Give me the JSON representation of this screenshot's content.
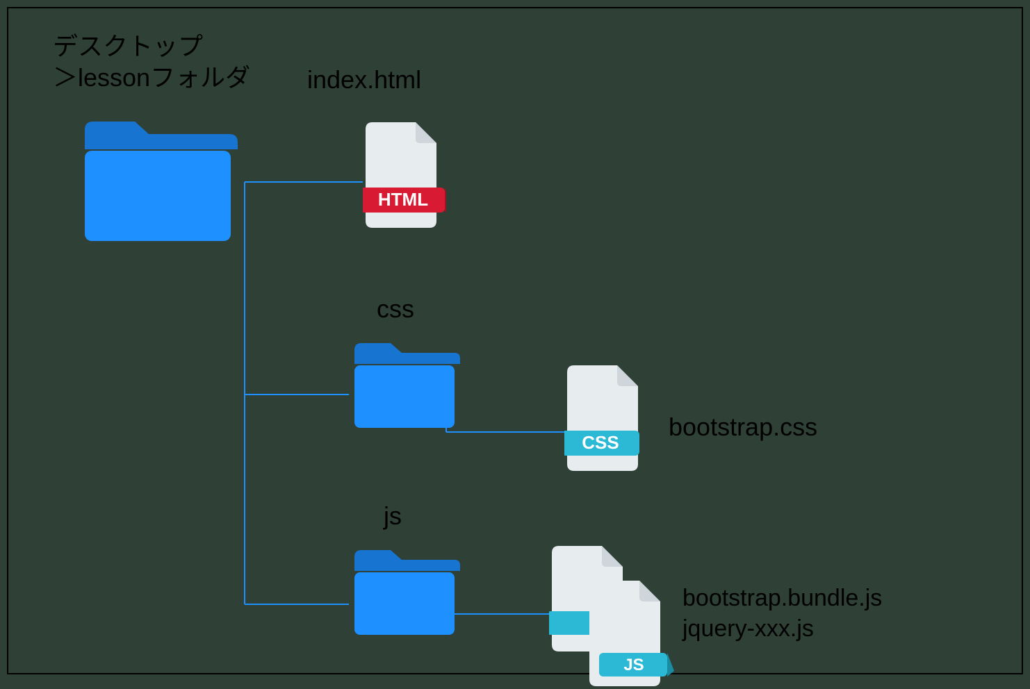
{
  "root": {
    "title_line1": "デスクトップ",
    "title_line2": "＞lessonフォルダ"
  },
  "children": {
    "html": {
      "label": "index.html",
      "badge": "HTML"
    },
    "css": {
      "label": "css",
      "file_badge": "CSS",
      "file_label": "bootstrap.css"
    },
    "js": {
      "label": "js",
      "file_badge": "JS",
      "file_label_1": "bootstrap.bundle.js",
      "file_label_2": "jquery-xxx.js"
    }
  },
  "colors": {
    "folder": "#1e90ff",
    "folder_dark": "#1874d1",
    "page": "#e7ecef",
    "page_fold": "#cfd6db",
    "html_ribbon": "#d81b32",
    "css_ribbon": "#2cb9d6",
    "js_ribbon": "#2cb9d6",
    "connector": "#1e90ff"
  }
}
